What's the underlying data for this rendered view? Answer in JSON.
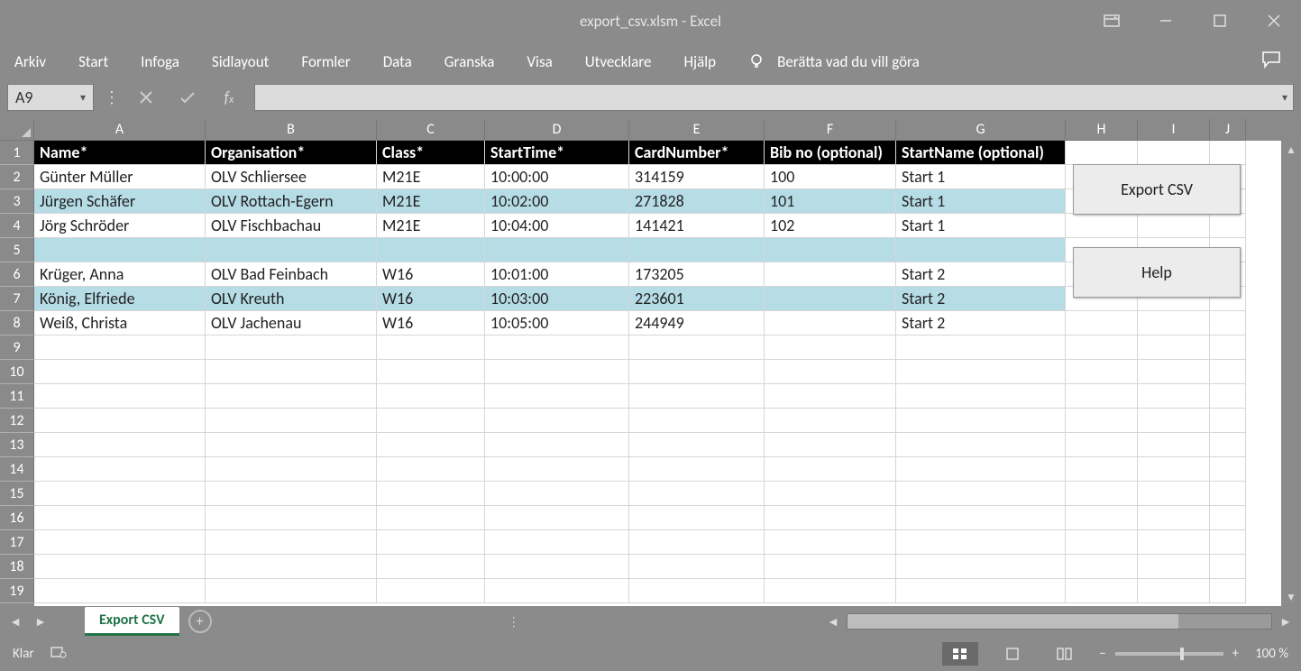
{
  "title": "export_csv.xlsm  -  Excel",
  "ribbon_tabs": [
    "Arkiv",
    "Start",
    "Infoga",
    "Sidlayout",
    "Formler",
    "Data",
    "Granska",
    "Visa",
    "Utvecklare",
    "Hjälp"
  ],
  "tellme": "Berätta vad du vill göra",
  "namebox": "A9",
  "formula": "",
  "columns": [
    "A",
    "B",
    "C",
    "D",
    "E",
    "F",
    "G",
    "H",
    "I",
    "J"
  ],
  "row_numbers": [
    "1",
    "2",
    "3",
    "4",
    "5",
    "6",
    "7",
    "8",
    "9",
    "10",
    "11",
    "12",
    "13",
    "14",
    "15",
    "16",
    "17",
    "18",
    "19"
  ],
  "table": {
    "headers": [
      "Name*",
      "Organisation*",
      "Class*",
      "StartTime*",
      "CardNumber*",
      "Bib no (optional)",
      "StartName (optional)"
    ],
    "rows": [
      {
        "a": "Günter Müller",
        "b": "OLV Schliersee",
        "c": "M21E",
        "d": "10:00:00",
        "e": "314159",
        "f": "100",
        "g": "Start 1"
      },
      {
        "a": "Jürgen Schäfer",
        "b": "OLV Rottach-Egern",
        "c": "M21E",
        "d": "10:02:00",
        "e": "271828",
        "f": "101",
        "g": "Start 1"
      },
      {
        "a": "Jörg Schröder",
        "b": "OLV Fischbachau",
        "c": "M21E",
        "d": "10:04:00",
        "e": "141421",
        "f": "102",
        "g": "Start 1"
      },
      {
        "a": "",
        "b": "",
        "c": "",
        "d": "",
        "e": "",
        "f": "",
        "g": ""
      },
      {
        "a": "Krüger, Anna",
        "b": "OLV Bad Feinbach",
        "c": "W16",
        "d": "10:01:00",
        "e": "173205",
        "f": "",
        "g": "Start 2"
      },
      {
        "a": "König, Elfriede",
        "b": "OLV Kreuth",
        "c": "W16",
        "d": "10:03:00",
        "e": "223601",
        "f": "",
        "g": "Start 2"
      },
      {
        "a": "Weiß, Christa",
        "b": "OLV Jachenau",
        "c": "W16",
        "d": "10:05:00",
        "e": "244949",
        "f": "",
        "g": "Start 2"
      }
    ]
  },
  "buttons": {
    "export": "Export CSV",
    "help": "Help"
  },
  "sheet_tab": "Export CSV",
  "status": "Klar",
  "zoom": "100 %"
}
